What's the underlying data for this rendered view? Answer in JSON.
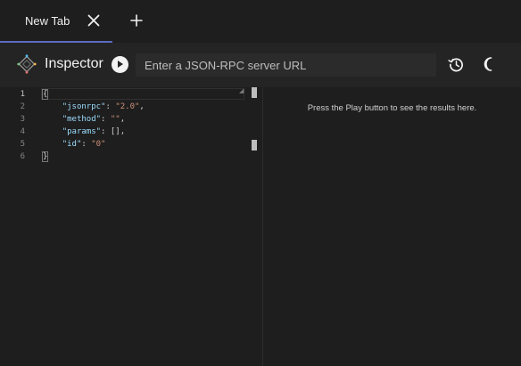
{
  "tabs": [
    {
      "label": "New Tab",
      "active": true
    }
  ],
  "header": {
    "title": "Inspector",
    "url_placeholder": "Enter a JSON-RPC server URL",
    "url_value": ""
  },
  "editor": {
    "line_numbers": [
      "1",
      "2",
      "3",
      "4",
      "5",
      "6"
    ],
    "lines": [
      [
        {
          "t": "{",
          "c": "brace"
        }
      ],
      [
        {
          "t": "    ",
          "c": "tok-punct"
        },
        {
          "t": "\"jsonrpc\"",
          "c": "tok-key"
        },
        {
          "t": ": ",
          "c": "tok-punct"
        },
        {
          "t": "\"2.0\"",
          "c": "tok-str"
        },
        {
          "t": ",",
          "c": "tok-punct"
        }
      ],
      [
        {
          "t": "    ",
          "c": "tok-punct"
        },
        {
          "t": "\"method\"",
          "c": "tok-key"
        },
        {
          "t": ": ",
          "c": "tok-punct"
        },
        {
          "t": "\"\"",
          "c": "tok-str"
        },
        {
          "t": ",",
          "c": "tok-punct"
        }
      ],
      [
        {
          "t": "    ",
          "c": "tok-punct"
        },
        {
          "t": "\"params\"",
          "c": "tok-key"
        },
        {
          "t": ": [],",
          "c": "tok-punct"
        }
      ],
      [
        {
          "t": "    ",
          "c": "tok-punct"
        },
        {
          "t": "\"id\"",
          "c": "tok-key"
        },
        {
          "t": ": ",
          "c": "tok-punct"
        },
        {
          "t": "\"0\"",
          "c": "tok-str"
        }
      ],
      [
        {
          "t": "}",
          "c": "brace"
        }
      ]
    ]
  },
  "results": {
    "hint": "Press the Play button to see the results here."
  },
  "colors": {
    "tab_indicator": "#5c6bc0",
    "json_key": "#9cdcfe",
    "json_string": "#ce9178"
  },
  "icons": {
    "tab_close": "close-icon",
    "new_tab": "plus-icon",
    "logo": "inspector-logo-icon",
    "run": "play-icon",
    "history": "history-icon",
    "theme": "moon-icon"
  }
}
